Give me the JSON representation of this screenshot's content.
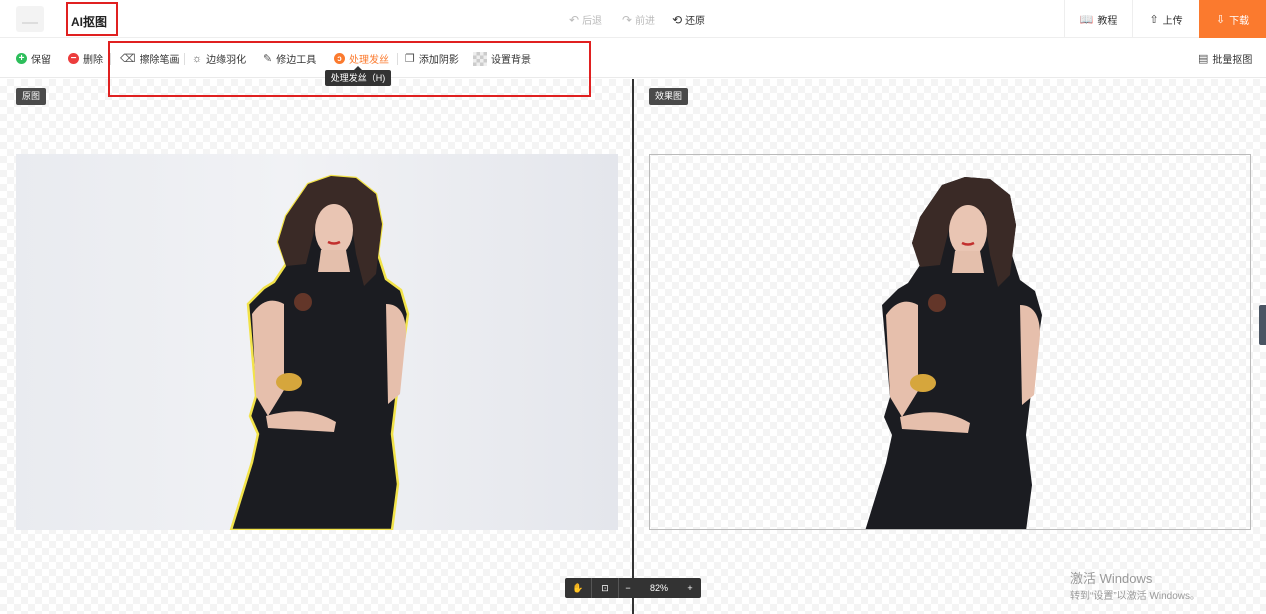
{
  "header": {
    "app_title": "AI抠图",
    "undo_label": "后退",
    "redo_label": "前进",
    "restore_label": "还原",
    "tutorial_label": "教程",
    "upload_label": "上传",
    "download_label": "下载"
  },
  "toolbar": {
    "keep_label": "保留",
    "delete_label": "删除",
    "erase_label": "擦除笔画",
    "feather_label": "边缘羽化",
    "edge_tool_label": "修边工具",
    "hair_label": "处理发丝",
    "shadow_label": "添加阴影",
    "background_label": "设置背景",
    "batch_label": "批量抠图",
    "tooltip": "处理发丝（H)"
  },
  "panels": {
    "original_label": "原图",
    "result_label": "效果图"
  },
  "zoom": {
    "value": "82%",
    "minus": "−",
    "plus": "+"
  },
  "watermark": {
    "title": "激活 Windows",
    "subtitle": "转到“设置”以激活 Windows。"
  },
  "colors": {
    "accent": "#fb7a2e",
    "highlight_box": "#e02020",
    "outline": "#f2e34a"
  }
}
